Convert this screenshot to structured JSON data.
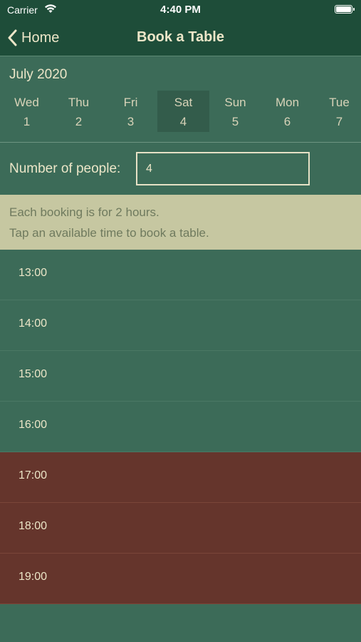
{
  "status_bar": {
    "carrier": "Carrier",
    "time": "4:40 PM"
  },
  "nav": {
    "back_label": "Home",
    "title": "Book a Table"
  },
  "calendar": {
    "month": "July 2020",
    "selected_index": 3,
    "days": [
      {
        "name": "Wed",
        "num": "1"
      },
      {
        "name": "Thu",
        "num": "2"
      },
      {
        "name": "Fri",
        "num": "3"
      },
      {
        "name": "Sat",
        "num": "4"
      },
      {
        "name": "Sun",
        "num": "5"
      },
      {
        "name": "Mon",
        "num": "6"
      },
      {
        "name": "Tue",
        "num": "7"
      }
    ]
  },
  "people": {
    "label": "Number of people:",
    "value": "4"
  },
  "info": {
    "line1": "Each booking is for 2 hours.",
    "line2": "Tap an available time to book a table."
  },
  "slots": [
    {
      "time": "13:00",
      "status": "available"
    },
    {
      "time": "14:00",
      "status": "available"
    },
    {
      "time": "15:00",
      "status": "available"
    },
    {
      "time": "16:00",
      "status": "available"
    },
    {
      "time": "17:00",
      "status": "booked"
    },
    {
      "time": "18:00",
      "status": "booked"
    },
    {
      "time": "19:00",
      "status": "booked"
    }
  ],
  "colors": {
    "nav_bg": "#1e4d39",
    "available": "#3c6b58",
    "booked": "#65352c",
    "info_bg": "#c6c7a1",
    "text": "#ece6c8"
  }
}
